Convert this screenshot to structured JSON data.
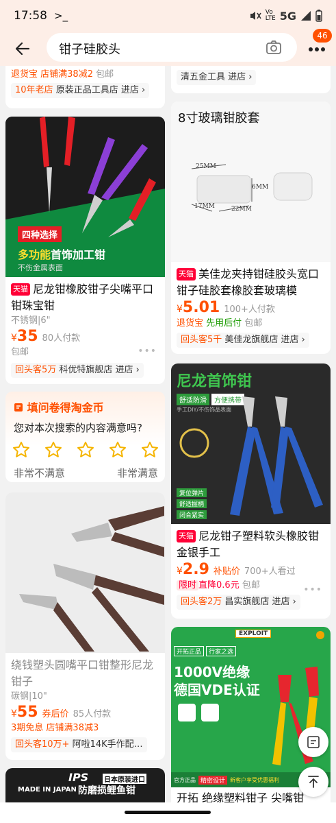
{
  "status": {
    "time": "17:58",
    "network": "5G"
  },
  "search": {
    "query": "钳子硅胶头",
    "badge": "46"
  },
  "partial_left": {
    "line1_a": "退货宝",
    "line1_b": "店铺满38减2",
    "line1_c": "包邮",
    "shop_tag": "10年老店",
    "shop": "原装正品工具店 进店 ›"
  },
  "partial_right": {
    "shop": "清五金工具 进店 ›"
  },
  "products": [
    {
      "image_caption_tag": "四种选择",
      "image_caption_main_a": "多功能",
      "image_caption_main_b": "首饰加工钳",
      "image_caption_sub": "不伤金属表面",
      "tag": "天猫",
      "title": "尼龙钳橡胶钳子尖嘴平口钳珠宝钳",
      "spec": "不锈钢|6\"",
      "price": "35",
      "sold": "80人付款",
      "line": "包邮",
      "shop_tag": "回头客5万",
      "shop": "科优特旗舰店 进店 ›"
    },
    {
      "image_title": "8寸玻璃钳胶套",
      "dim_a": "25MM",
      "dim_b": "6MM",
      "dim_c": "17MM",
      "dim_d": "22MM",
      "tag": "天猫",
      "title": "美佳龙夹持钳硅胶头宽口钳子硅胶套橡胶套玻璃模",
      "price": "5.01",
      "sold": "100+人付款",
      "line_a": "退货宝",
      "line_b": "先用后付",
      "line_c": "包邮",
      "shop_tag": "回头客5千",
      "shop": "美佳龙旗舰店 进店 ›"
    },
    {
      "image_title": "尼龙首饰钳",
      "img_badge_a": "舒适防滑",
      "img_badge_b": "方便携带",
      "img_sub": "手工DIY/不伤饰品表面",
      "feat_a": "复位弹片",
      "feat_b": "舒适握柄",
      "feat_c": "闭合紧实",
      "tag": "天猫",
      "title": "尼龙钳子塑料软头橡胶钳金银手工",
      "price": "2.9",
      "price_note": "补贴价",
      "sold": "700+人看过",
      "limit_a": "限时",
      "limit_b": "直降0.6元",
      "limit_c": "包邮",
      "shop_tag": "回头客2万",
      "shop": "昌实旗舰店 进店 ›"
    },
    {
      "title": "绕钱塑头圆嘴平口钳整形尼龙钳子",
      "spec": "碳钢|10\"",
      "price": "55",
      "price_note": "券后价",
      "sold": "85人付款",
      "line_a": "3期免息",
      "line_b": "店铺满38减3",
      "shop_tag": "回头客10万+",
      "shop": "阿啦14K手作配…"
    },
    {
      "brand": "EXPLOIT",
      "img_tag_a": "开拓正品",
      "img_tag_b": "行家之选",
      "img_main_a": "1000V绝缘",
      "img_main_b": "德国VDE认证",
      "img_footer_a": "官方正品",
      "img_footer_b": "精密设计",
      "img_footer_c": "新客户享受优惠福利",
      "title": "开拓 绝缘塑料钳子 尖嘴钳"
    },
    {
      "brand": "IPS",
      "brand_sub": "日本原装进口",
      "made_in": "MADE IN JAPAN",
      "img_main": "防磨损鲤鱼钳"
    }
  ],
  "survey": {
    "title": "填问卷得淘金币",
    "question": "您对本次搜索的内容满意吗?",
    "low": "非常不满意",
    "high": "非常满意"
  },
  "colors": {
    "accent": "#ff5000",
    "tmall": "#ff0036",
    "header_bg": "#fdeee7"
  }
}
